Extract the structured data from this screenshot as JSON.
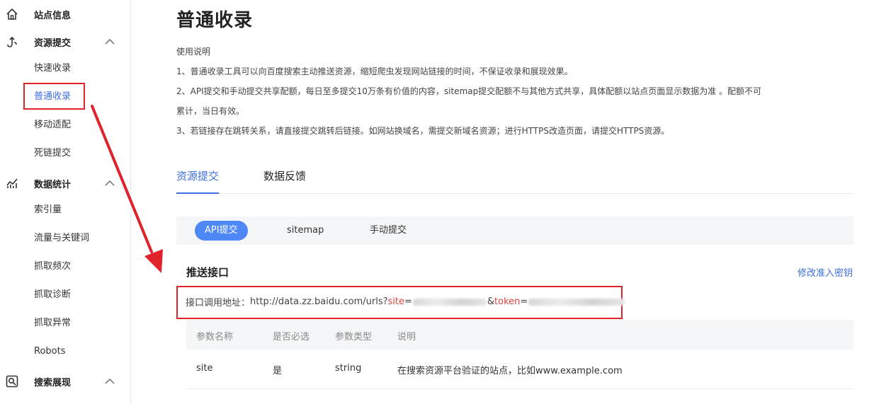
{
  "sidebar": {
    "site_info": "站点信息",
    "resource_submit": "资源提交",
    "resource_items": [
      "快速收录",
      "普通收录",
      "移动适配",
      "死链提交"
    ],
    "data_stats": "数据统计",
    "stats_items": [
      "索引量",
      "流量与关键词",
      "抓取频次",
      "抓取诊断",
      "抓取异常",
      "Robots"
    ],
    "search_display": "搜索展现"
  },
  "page": {
    "title": "普通收录",
    "usage_title": "使用说明",
    "usage_lines": [
      "1、普通收录工具可以向百度搜索主动推送资源，缩短爬虫发现网站链接的时间，不保证收录和展现效果。",
      "2、API提交和手动提交共享配额，每日至多提交10万条有价值的内容，sitemap提交配额不与其他方式共享，具体配额以站点页面显示数据为准 。配额不可",
      "累计，当日有效。",
      "3、若链接存在跳转关系，请直接提交跳转后链接。如网站换域名，需提交新域名资源；进行HTTPS改造页面，请提交HTTPS资源。"
    ]
  },
  "tabs": [
    "资源提交",
    "数据反馈"
  ],
  "subtabs": [
    "API提交",
    "sitemap",
    "手动提交"
  ],
  "push_section": {
    "title": "推送接口",
    "edit_link": "修改准入密钥",
    "api_label": "接口调用地址：",
    "api_url": "http://data.zz.baidu.com/urls?",
    "site_key": "site",
    "eq": "=",
    "amp": "&",
    "token_key": "token"
  },
  "params_table": {
    "headers": [
      "参数名称",
      "是否必选",
      "参数类型",
      "说明"
    ],
    "rows": [
      [
        "site",
        "是",
        "string",
        "在搜索资源平台验证的站点，比如www.example.com"
      ]
    ]
  },
  "colors": {
    "accent": "#3d6fe0",
    "pill": "#4e88f7",
    "annotation_red": "#e0232b"
  }
}
